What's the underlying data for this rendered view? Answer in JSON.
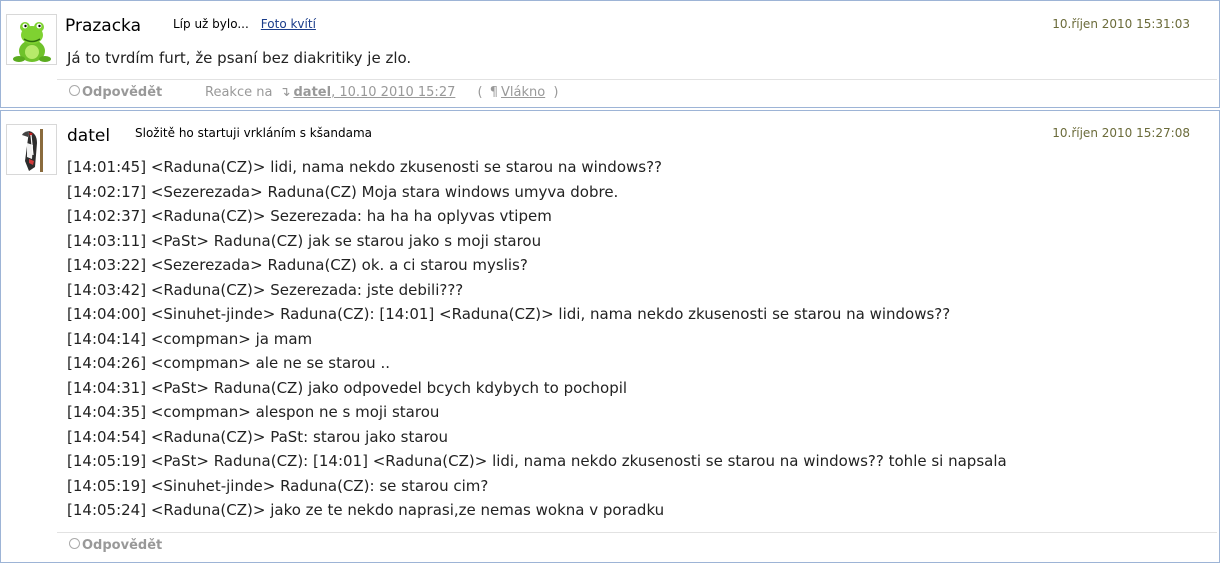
{
  "posts": [
    {
      "author": "Prazacka",
      "subject": "Líp už bylo...",
      "subject_link": "Foto kvítí",
      "date": "10.říjen 2010 15:31:03",
      "body": "Já to tvrdím furt, že psaní bez diakritiky je zlo.",
      "reply_label": "Odpovědět",
      "reaction_prefix": "Reakce na",
      "reaction_author": "datel",
      "reaction_date": ", 10.10 2010 15:27",
      "thread_label": "Vlákno",
      "avatar_icon": "green-frog-avatar-icon"
    },
    {
      "author": "datel",
      "subject": "Složitě ho startuji vrkláním s kšandama",
      "date": "10.říjen 2010 15:27:08",
      "lines": [
        "[14:01:45] <Raduna(CZ)> lidi, nama nekdo zkusenosti se starou na windows??",
        "[14:02:17] <Sezerezada> Raduna(CZ) Moja stara windows umyva dobre.",
        "[14:02:37] <Raduna(CZ)> Sezerezada: ha ha ha oplyvas vtipem",
        "[14:03:11] <PaSt> Raduna(CZ) jak se starou jako s moji starou",
        "[14:03:22] <Sezerezada> Raduna(CZ) ok. a ci starou myslis?",
        "[14:03:42] <Raduna(CZ)> Sezerezada: jste debili???",
        "[14:04:00] <Sinuhet-jinde> Raduna(CZ): [14:01] <Raduna(CZ)> lidi, nama nekdo zkusenosti se starou na windows??",
        "[14:04:14] <compman> ja mam",
        "[14:04:26] <compman> ale ne se starou ..",
        "[14:04:31] <PaSt> Raduna(CZ) jako odpovedel bcych kdybych to pochopil",
        "[14:04:35] <compman> alespon ne s moji starou",
        "[14:04:54] <Raduna(CZ)> PaSt: starou jako starou",
        "[14:05:19] <PaSt> Raduna(CZ): [14:01] <Raduna(CZ)> lidi, nama nekdo zkusenosti se starou na windows?? tohle si napsala",
        "[14:05:19] <Sinuhet-jinde> Raduna(CZ): se starou cim?",
        "[14:05:24] <Raduna(CZ)> jako ze te nekdo naprasi,ze nemas wokna v poradku"
      ],
      "reply_label": "Odpovědět",
      "avatar_icon": "woodpecker-avatar-icon"
    }
  ]
}
